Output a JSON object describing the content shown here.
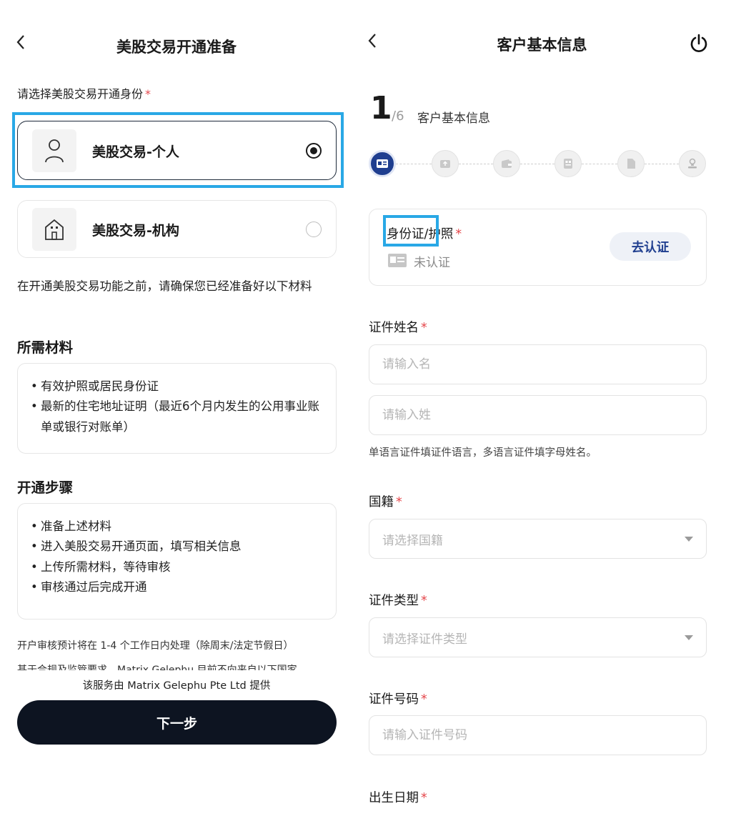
{
  "left": {
    "back_icon": "chevron-left-icon",
    "title": "美股交易开通准备",
    "question": "请选择美股交易开通身份",
    "required_mark": "*",
    "options": [
      {
        "label": "美股交易-个人",
        "icon": "person-icon",
        "selected": true
      },
      {
        "label": "美股交易-机构",
        "icon": "building-icon",
        "selected": false
      }
    ],
    "intro": "在开通美股交易功能之前，请确保您已经准备好以下材料",
    "materials": {
      "title": "所需材料",
      "items": [
        "有效护照或居民身份证",
        "最新的住宅地址证明（最近6个月内发生的公用事业账单或银行对账单）"
      ]
    },
    "steps": {
      "title": "开通步骤",
      "items": [
        "准备上述材料",
        "进入美股交易开通页面，填写相关信息",
        "上传所需材料，等待审核",
        "审核通过后完成开通"
      ]
    },
    "fine_print_1": "开户审核预计将在 1-4 个工作日内处理（除周末/法定节假日）",
    "fine_print_2": "基于合规及监管要求，Matrix Gelephu 目前不向来自以下国家",
    "provided_by": "该服务由 Matrix Gelephu Pte Ltd 提供",
    "next_button": "下一步"
  },
  "right": {
    "back_icon": "chevron-left-icon",
    "title": "客户基本信息",
    "power_icon": "power-icon",
    "step_current": "1",
    "step_total": "/6",
    "step_name": "客户基本信息",
    "stepper_icons": [
      "id-card-icon",
      "upload-icon",
      "wallet-icon",
      "form-icon",
      "document-icon",
      "stamp-icon"
    ],
    "id_card": {
      "title": "身份证/护照",
      "status": "未认证",
      "verify_button": "去认证"
    },
    "required_mark": "*",
    "fields": {
      "name_label": "证件姓名",
      "first_name_placeholder": "请输入名",
      "last_name_placeholder": "请输入姓",
      "name_hint": "单语言证件填证件语言，多语言证件填字母姓名。",
      "nationality_label": "国籍",
      "nationality_placeholder": "请选择国籍",
      "id_type_label": "证件类型",
      "id_type_placeholder": "请选择证件类型",
      "id_number_label": "证件号码",
      "id_number_placeholder": "请输入证件号码",
      "dob_label": "出生日期"
    }
  },
  "colors": {
    "highlight": "#29a8e6",
    "primary_dark": "#0d1421",
    "accent_blue": "#1f3e8f",
    "required": "#e5484d"
  }
}
